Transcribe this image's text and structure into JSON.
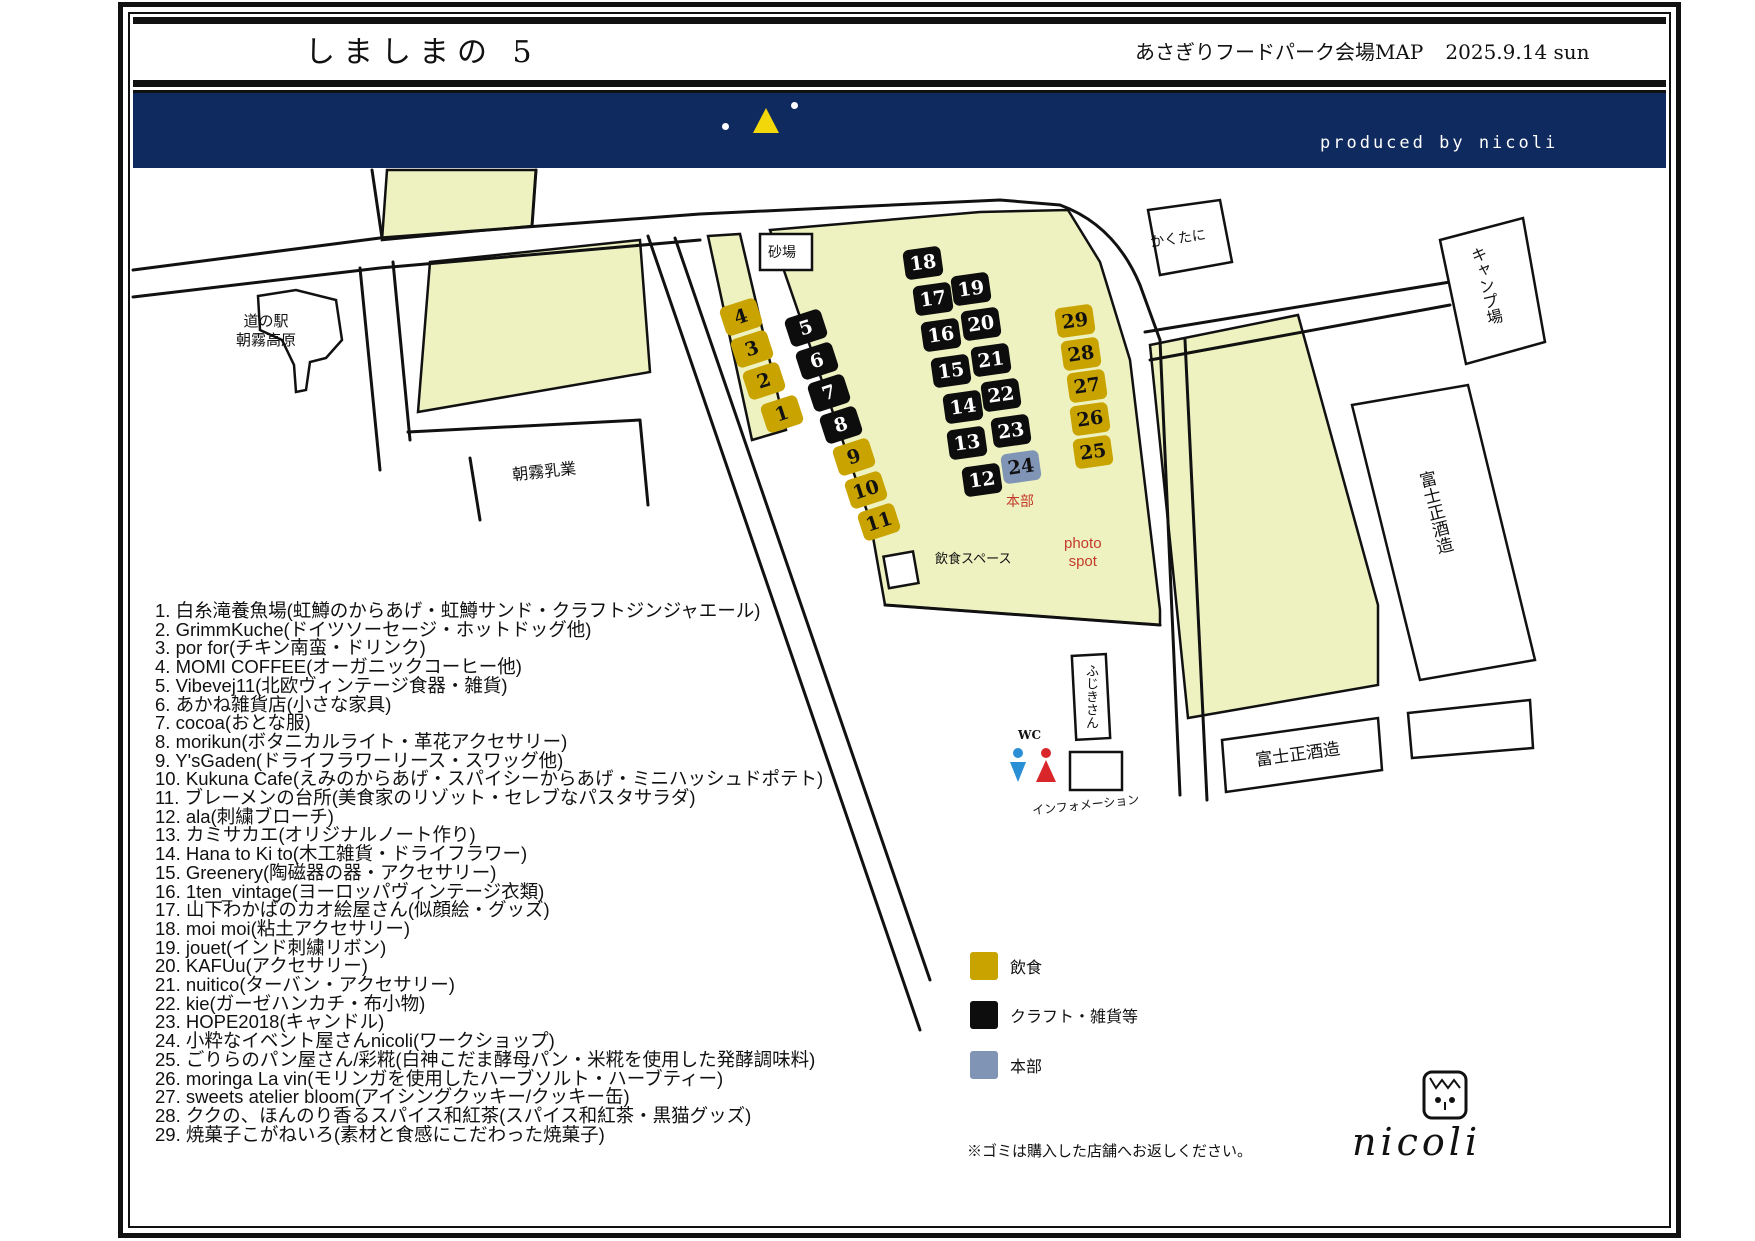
{
  "header": {
    "left_title": "しましまの 5",
    "event_title": "あさぎりフードパーク会場MAP",
    "date": "2025.9.14 sun"
  },
  "banner": {
    "produced_by": "produced by nicoli"
  },
  "map": {
    "places": {
      "michinoeki": "道の駅\n朝霧高原",
      "asagiri_nyugyo": "朝霧乳業",
      "sunaba": "砂場",
      "kakutani": "かくたに",
      "camp": "キャンプ場",
      "fujimasa_right": "富士正酒造",
      "fujimasa_bottom": "富士正酒造",
      "fujikisan": "ふじきさん",
      "wc": "WC",
      "information": "インフォメーション",
      "dining_space": "飲食スペース",
      "photo_spot": "photo\nspot",
      "honbu": "本部"
    },
    "booths": [
      {
        "num": "1",
        "type": "food"
      },
      {
        "num": "2",
        "type": "food"
      },
      {
        "num": "3",
        "type": "food"
      },
      {
        "num": "4",
        "type": "food"
      },
      {
        "num": "5",
        "type": "craft"
      },
      {
        "num": "6",
        "type": "craft"
      },
      {
        "num": "7",
        "type": "craft"
      },
      {
        "num": "8",
        "type": "craft"
      },
      {
        "num": "9",
        "type": "food"
      },
      {
        "num": "10",
        "type": "food"
      },
      {
        "num": "11",
        "type": "food"
      },
      {
        "num": "12",
        "type": "craft"
      },
      {
        "num": "13",
        "type": "craft"
      },
      {
        "num": "14",
        "type": "craft"
      },
      {
        "num": "15",
        "type": "craft"
      },
      {
        "num": "16",
        "type": "craft"
      },
      {
        "num": "17",
        "type": "craft"
      },
      {
        "num": "18",
        "type": "craft"
      },
      {
        "num": "19",
        "type": "craft"
      },
      {
        "num": "20",
        "type": "craft"
      },
      {
        "num": "21",
        "type": "craft"
      },
      {
        "num": "22",
        "type": "craft"
      },
      {
        "num": "23",
        "type": "craft"
      },
      {
        "num": "24",
        "type": "hq"
      },
      {
        "num": "25",
        "type": "food"
      },
      {
        "num": "26",
        "type": "food"
      },
      {
        "num": "27",
        "type": "food"
      },
      {
        "num": "28",
        "type": "food"
      },
      {
        "num": "29",
        "type": "food"
      }
    ]
  },
  "vendors": [
    "1. 白糸滝養魚場(虹鱒のからあげ・虹鱒サンド・クラフトジンジャエール)",
    "2. GrimmKuche(ドイツソーセージ・ホットドッグ他)",
    "3. por for(チキン南蛮・ドリンク)",
    "4. MOMI COFFEE(オーガニックコーヒー他)",
    "5. Vibevej11(北欧ヴィンテージ食器・雑貨)",
    "6. あかね雑貨店(小さな家具)",
    "7. cocoa(おとな服)",
    "8. morikun(ボタニカルライト・革花アクセサリー)",
    "9. Y'sGaden(ドライフラワーリース・スワッグ他)",
    "10. Kukuna Cafe(えみのからあげ・スパイシーからあげ・ミニハッシュドポテト)",
    "11. ブレーメンの台所(美食家のリゾット・セレブなパスタサラダ)",
    "12. ala(刺繍ブローチ)",
    "13. カミサカエ(オリジナルノート作り)",
    "14. Hana to Ki to(木工雑貨・ドライフラワー)",
    "15. Greenery(陶磁器の器・アクセサリー)",
    "16. 1ten_vintage(ヨーロッパヴィンテージ衣類)",
    "17. 山下わかばのカオ絵屋さん(似顔絵・グッズ)",
    "18. moi moi(粘土アクセサリー)",
    "19. jouet(インド刺繍リボン)",
    "20. KAFUu(アクセサリー)",
    "21. nuitico(ターバン・アクセサリー)",
    "22. kie(ガーゼハンカチ・布小物)",
    "23. HOPE2018(キャンドル)",
    "24. 小粋なイベント屋さんnicoli(ワークショップ)",
    "25. ごりらのパン屋さん/彩糀(白神こだま酵母パン・米糀を使用した発酵調味料)",
    "26. moringa La vin(モリンガを使用したハーブソルト・ハーブティー)",
    "27. sweets atelier bloom(アイシングクッキー/クッキー缶)",
    "28. ククの、ほんのり香るスパイス和紅茶(スパイス和紅茶・黒猫グッズ)",
    "29. 焼菓子こがねいろ(素材と食感にこだわった焼菓子)"
  ],
  "legend": {
    "food": "飲食",
    "craft": "クラフト・雑貨等",
    "hq": "本部"
  },
  "colors": {
    "food": "#c9a300",
    "craft": "#0d0d0d",
    "hq": "#8095b5",
    "navy": "#0f2a5e",
    "grass": "#eef2c0"
  },
  "note": "※ゴミは購入した店舗へお返しください。",
  "logo_text": "nicoli"
}
